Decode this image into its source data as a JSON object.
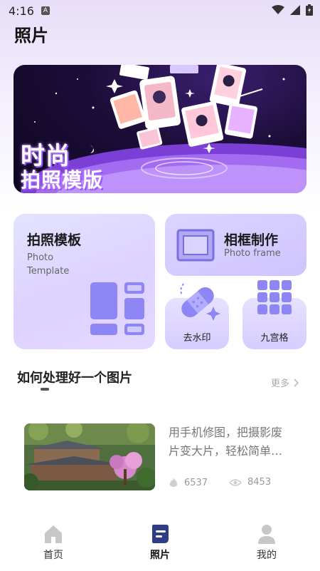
{
  "status_bar": {
    "time": "4:16",
    "badge": "A"
  },
  "page": {
    "title": "照片"
  },
  "banner": {
    "line1": "时尚",
    "line2": "拍照模版"
  },
  "cards": {
    "template": {
      "title": "拍照模板",
      "subtitle_line1": "Photo",
      "subtitle_line2": "Template"
    },
    "frame": {
      "title": "相框制作",
      "subtitle": "Photo frame"
    },
    "watermark": {
      "label": "去水印"
    },
    "grid9": {
      "label": "九宫格"
    }
  },
  "section": {
    "title": "如何处理好一个图片",
    "more": "更多"
  },
  "article": {
    "line1": "用手机修图，把摄影废",
    "line2": "片变大片，轻松简单…",
    "likes": "6537",
    "views": "8453"
  },
  "nav": {
    "items": [
      {
        "label": "首页",
        "icon": "home-icon"
      },
      {
        "label": "照片",
        "icon": "document-icon"
      },
      {
        "label": "我的",
        "icon": "profile-icon"
      }
    ]
  },
  "colors": {
    "accent": "#8c76f5",
    "nav_active": "#2f3d86"
  }
}
